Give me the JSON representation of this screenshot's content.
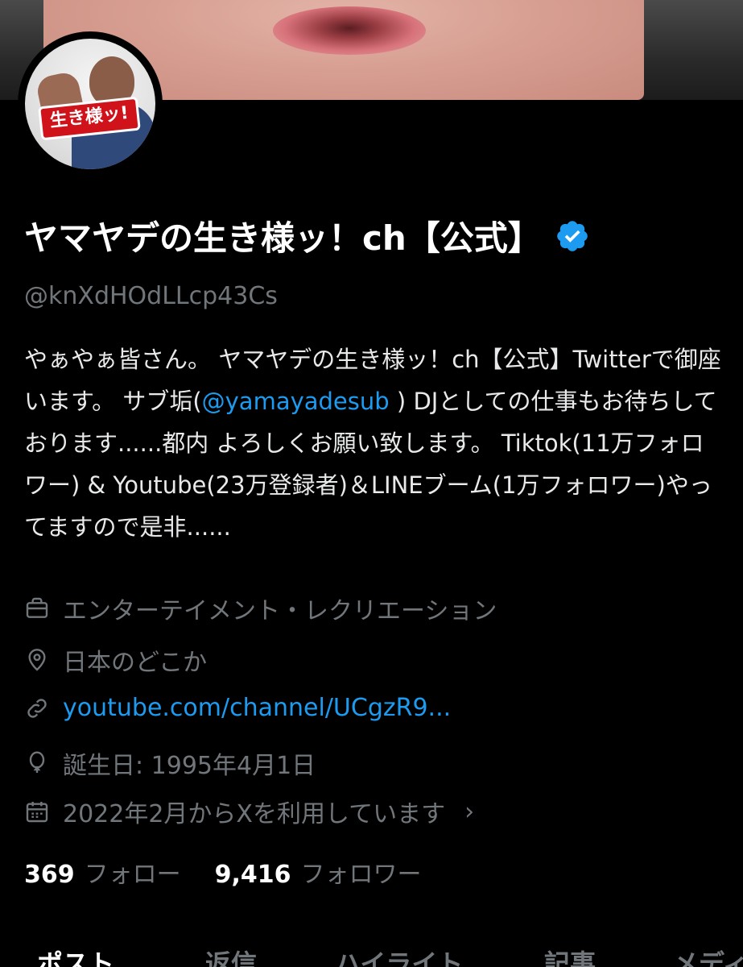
{
  "profile": {
    "display_name": "ヤマヤデの生き様ッ！ch【公式】",
    "handle": "@knXdHOdLLcp43Cs",
    "avatar_text": "生き様ッ!",
    "verified": true,
    "bio_before": "やぁやぁ皆さん。 ヤマヤデの生き様ッ！ch【公式】Twitterで御座います。 サブ垢(",
    "bio_mention": "@yamayadesub",
    "bio_after": " ) DJとしての仕事もお待ちしております......都内 よろしくお願い致します。 Tiktok(11万フォロワー) & Youtube(23万登録者)＆LINEブーム(1万フォロワー)やってますので是非......",
    "category": "エンターテイメント・レクリエーション",
    "location": "日本のどこか",
    "url": "youtube.com/channel/UCgzR9...",
    "birthday": "誕生日: 1995年4月1日",
    "joined": "2022年2月からXを利用しています",
    "joined_chevron": "›"
  },
  "stats": {
    "following_count": "369",
    "following_label": "フォロー",
    "followers_count": "9,416",
    "followers_label": "フォロワー"
  },
  "tabs": [
    "ポスト",
    "返信",
    "ハイライト",
    "記事",
    "メディア"
  ],
  "colors": {
    "background": "#000000",
    "text": "#e7e9ea",
    "muted": "#71767b",
    "link": "#1d9bf0",
    "verified": "#1d9bf0"
  },
  "icons": {
    "category": "briefcase-icon",
    "location": "location-pin-icon",
    "url": "link-icon",
    "birthday": "balloon-icon",
    "joined": "calendar-icon",
    "verified": "verified-badge-icon"
  }
}
